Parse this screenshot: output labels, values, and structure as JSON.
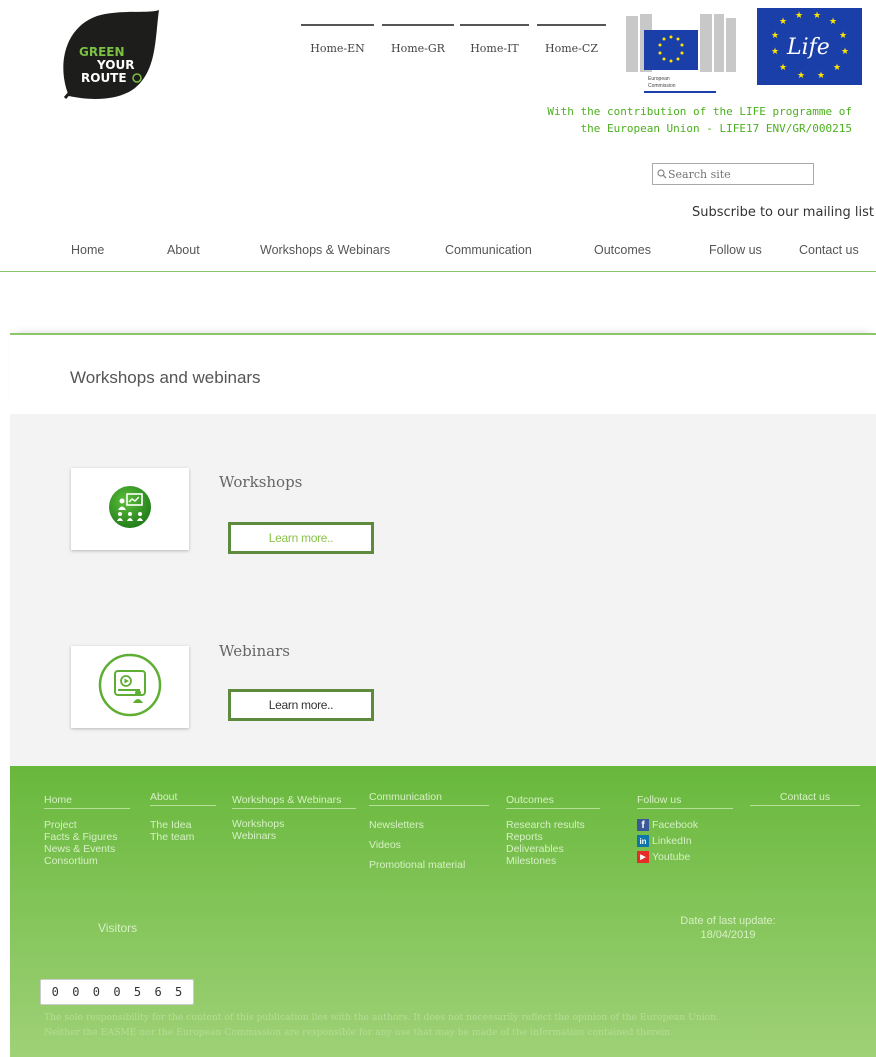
{
  "logo": {
    "text_lines": [
      "GREEN",
      "YOUR",
      "ROUTE"
    ]
  },
  "language_links": [
    "Home-EN",
    "Home-GR",
    "Home-IT",
    "Home-CZ"
  ],
  "eu_logo": {
    "lines": [
      "European",
      "Commission"
    ]
  },
  "life_logo": {
    "text": "Life"
  },
  "life_note": {
    "line1": "With the contribution of the LIFE programme of",
    "line2": "the European Union - LIFE17 ENV/GR/000215"
  },
  "search": {
    "placeholder": "Search site",
    "icon": "magnifier-icon"
  },
  "subscribe_label": "Subscribe to our mailing list",
  "main_nav": [
    "Home",
    "About",
    "Workshops & Webinars",
    "Communication",
    "Outcomes",
    "Follow us",
    "Contact us"
  ],
  "page_title": "Workshops and webinars",
  "cards": [
    {
      "title": "Workshops",
      "button": "Learn more..",
      "icon": "presentation-icon"
    },
    {
      "title": "Webinars",
      "button": "Learn more..",
      "icon": "video-player-icon"
    }
  ],
  "footer": {
    "columns": [
      {
        "head": "Home",
        "links": [
          "Project",
          "Facts & Figures",
          "News & Events",
          "Consortium"
        ]
      },
      {
        "head": "About",
        "links": [
          "The Idea",
          "The team"
        ]
      },
      {
        "head": "Workshops & Webinars",
        "links": [
          "Workshops",
          "Webinars"
        ]
      },
      {
        "head": "Communication",
        "links": [
          "Newsletters",
          "Videos",
          "Promotional material"
        ]
      },
      {
        "head": "Outcomes",
        "links": [
          "Research results",
          "Reports",
          "Deliverables",
          "Milestones"
        ]
      },
      {
        "head": "Follow us",
        "links": []
      },
      {
        "head": "Contact us",
        "links": []
      }
    ],
    "social": [
      {
        "label": "Facebook",
        "icon": "facebook-icon",
        "glyph": "f",
        "color": "#3b5998"
      },
      {
        "label": "LinkedIn",
        "icon": "linkedin-icon",
        "glyph": "in",
        "color": "#0e76a8"
      },
      {
        "label": "Youtube",
        "icon": "youtube-icon",
        "glyph": "▶",
        "color": "#e52d27"
      }
    ],
    "visitors_label": "Visitors",
    "visitor_digits": [
      "0",
      "0",
      "0",
      "0",
      "5",
      "6",
      "5"
    ],
    "update_label": "Date of last update:",
    "update_date": "18/04/2019",
    "disclaimer_line1": "The sole responsibility for the content of this publication lies with the authors. It does not necessarily reflect the opinion of the European Union.",
    "disclaimer_line2": "Neither the EASME nor the European Commission are responsible for any use that may be made of the information contained therein."
  },
  "colors": {
    "accent_green": "#4caf1f",
    "footer_green": "#68b83c",
    "button_border": "#5e8a3e",
    "eu_blue": "#1a3fa8"
  }
}
